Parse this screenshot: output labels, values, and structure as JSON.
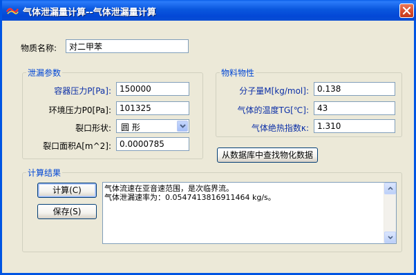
{
  "window": {
    "title": "气体泄漏量计算--气体泄漏量计算"
  },
  "material": {
    "label": "物质名称:",
    "value": "对二甲苯"
  },
  "leak_params": {
    "title": "泄漏参数",
    "container_pressure_label": "容器压力P[Pa]:",
    "container_pressure_value": "150000",
    "ambient_pressure_label": "环境压力P0[Pa]:",
    "ambient_pressure_value": "101325",
    "shape_label": "裂口形状:",
    "shape_value": "圆  形",
    "area_label": "裂口面积A[m^2]:",
    "area_value": "0.0000785"
  },
  "physical_props": {
    "title": "物料物性",
    "molecular_weight_label": "分子量M[kg/mol]:",
    "molecular_weight_value": "0.138",
    "gas_temp_label": "气体的温度TG[℃]:",
    "gas_temp_value": "43",
    "adiabatic_label": "气体绝热指数κ:",
    "adiabatic_value": "1.310",
    "lookup_button": "从数据库中查找物化数据"
  },
  "results": {
    "title": "计算结果",
    "calc_button": "计算(C)",
    "save_button": "保存(S)",
    "line1": "气体流速在亚音速范围，是次临界流。",
    "line2": "气体泄漏速率为：0.0547413816911464 kg/s。"
  },
  "colors": {
    "titlebar": "#0a57de",
    "window_bg": "#ece9d8",
    "group_title": "#0046d5",
    "label_blue": "#0b2fa7"
  },
  "icons": {
    "app": "app-logo-icon",
    "close": "close-icon",
    "dropdown": "chevron-down-icon",
    "scroll_up": "scroll-up-icon",
    "scroll_down": "scroll-down-icon"
  }
}
